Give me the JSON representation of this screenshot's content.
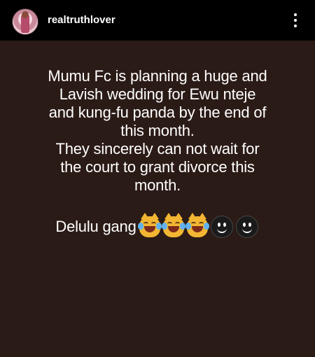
{
  "header": {
    "username": "realtruthlover",
    "avatar_icon": "profile-avatar",
    "more_icon": "more-vertical-icon"
  },
  "story": {
    "background_color": "#2b1b16",
    "lines_block1": [
      "Mumu Fc is planning a huge and",
      "Lavish wedding for Ewu nteje",
      "and kung-fu panda by the end of",
      "this month.",
      "They sincerely can not wait for",
      "the court to grant divorce this",
      "month."
    ],
    "gang_label": "Delulu gang",
    "emojis": [
      "crying-laughing-cat",
      "crying-laughing-cat",
      "crying-laughing-cat",
      "dark-smiley",
      "dark-smiley"
    ]
  }
}
